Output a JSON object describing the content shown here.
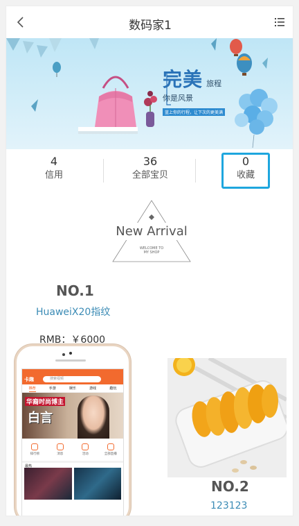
{
  "header": {
    "title": "数码家1"
  },
  "banner": {
    "title": "完美",
    "title_suffix": "旅程",
    "subtitle": "你是风景",
    "note": "蓝上你的行程，让下次的更美满"
  },
  "stats": [
    {
      "value": "4",
      "label": "信用"
    },
    {
      "value": "36",
      "label": "全部宝贝"
    },
    {
      "value": "0",
      "label": "收藏"
    }
  ],
  "arrival": {
    "title": "New Arrival",
    "line1": "WELCOME TO",
    "line2": "MY SHOP"
  },
  "products": [
    {
      "rank": "NO.1",
      "name": "HuaweiX20指纹",
      "price": "RMB：￥6000"
    },
    {
      "rank": "NO.2",
      "name": "123123"
    }
  ],
  "phone_app": {
    "logo": "卡趣",
    "search_placeholder": "搜索视频",
    "tabs": [
      "推荐",
      "手游",
      "娱乐",
      "游戏",
      "趣玩"
    ],
    "hero_line1": "华裔时尚博主",
    "hero_line2": "白言",
    "icons": [
      "排行榜",
      "消息",
      "活动",
      "全部直播"
    ],
    "section": "最热"
  },
  "colors": {
    "accent": "#1ea6de",
    "link": "#3b8bb5",
    "app_orange": "#f26a2e"
  }
}
